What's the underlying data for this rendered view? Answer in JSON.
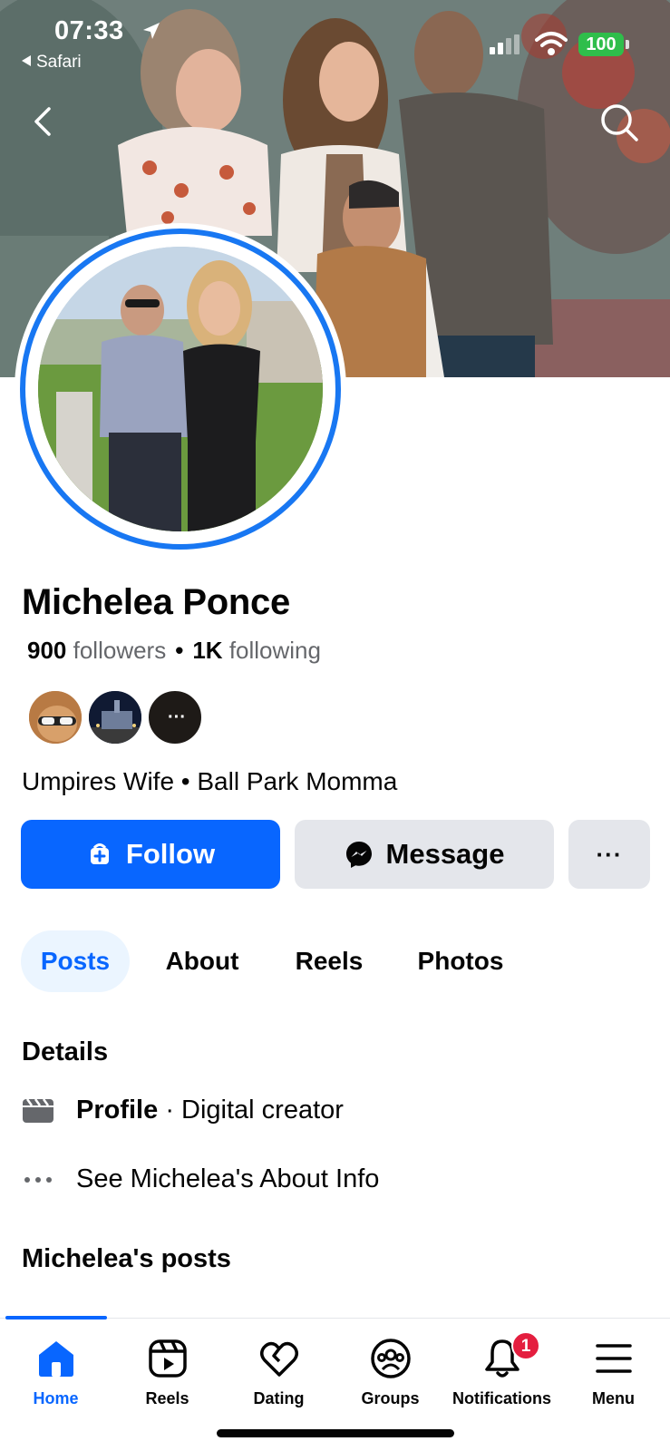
{
  "status_bar": {
    "time": "07:33",
    "back_app": "Safari",
    "battery": "100"
  },
  "profile": {
    "name": "Michelea Ponce",
    "followers_count": "900",
    "followers_label": "followers",
    "following_count": "1K",
    "following_label": "following",
    "bio": "Umpires Wife • Ball Park Momma",
    "mutual_overflow": "···"
  },
  "actions": {
    "follow_label": "Follow",
    "message_label": "Message",
    "more_label": "···"
  },
  "tabs": [
    {
      "label": "Posts",
      "active": true
    },
    {
      "label": "About",
      "active": false
    },
    {
      "label": "Reels",
      "active": false
    },
    {
      "label": "Photos",
      "active": false
    }
  ],
  "details": {
    "heading": "Details",
    "profile_label": "Profile",
    "profile_value": "· Digital creator",
    "about_link": "See Michelea's About Info",
    "posts_heading": "Michelea's posts"
  },
  "bottom_nav": [
    {
      "label": "Home",
      "icon": "home-icon",
      "active": true
    },
    {
      "label": "Reels",
      "icon": "reels-icon",
      "active": false
    },
    {
      "label": "Dating",
      "icon": "dating-icon",
      "active": false
    },
    {
      "label": "Groups",
      "icon": "groups-icon",
      "active": false
    },
    {
      "label": "Notifications",
      "icon": "bell-icon",
      "active": false,
      "badge": "1"
    },
    {
      "label": "Menu",
      "icon": "menu-icon",
      "active": false
    }
  ],
  "colors": {
    "primary": "#0866ff",
    "secondary_button": "#e4e6eb",
    "active_tab_bg": "#ebf5ff",
    "badge": "#e41e3f"
  }
}
